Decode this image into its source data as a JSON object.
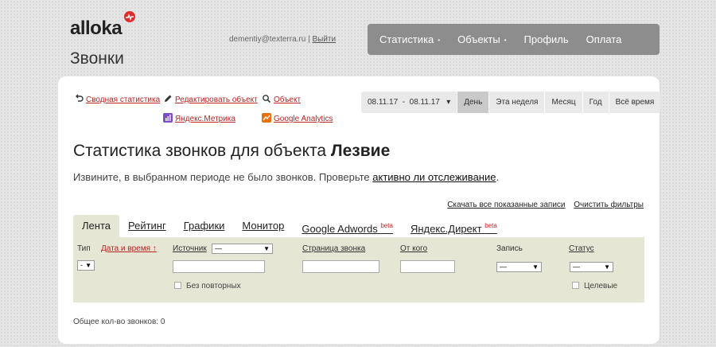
{
  "header": {
    "logo_text": "alloka",
    "page_title": "Звонки",
    "user_email": "dementiy@texterra.ru",
    "separator": "|",
    "logout_label": "Выйти"
  },
  "topnav": {
    "items": [
      {
        "label": "Статистика",
        "has_caret": true
      },
      {
        "label": "Объекты",
        "has_caret": true
      },
      {
        "label": "Профиль",
        "has_caret": false
      },
      {
        "label": "Оплата",
        "has_caret": false
      }
    ],
    "caret": "•",
    "bg_color": "#8d8d8d"
  },
  "actions": {
    "summary_stats": "Сводная статистика",
    "edit_object": "Редактировать объект",
    "object": "Объект",
    "yandex_metrika": "Яндекс.Метрика",
    "google_analytics": "Google Analytics"
  },
  "period": {
    "date_from": "08.11.17",
    "dash": "-",
    "date_to": "08.11.17",
    "dropdown_caret": "▾",
    "options": [
      "День",
      "Эта неделя",
      "Месяц",
      "Год",
      "Всё время"
    ],
    "active": "День"
  },
  "main": {
    "heading_prefix": "Статистика звонков для объекта ",
    "object_name": "Лезвие",
    "notice_text": "Извините, в выбранном периоде не было звонков. Проверьте ",
    "notice_link": "активно ли отслеживание",
    "notice_end": "."
  },
  "table_links": {
    "download_all": "Скачать все показанные записи",
    "clear_filters": "Очистить фильтры"
  },
  "tabs": [
    {
      "label": "Лента",
      "active": true,
      "beta": ""
    },
    {
      "label": "Рейтинг",
      "active": false,
      "beta": ""
    },
    {
      "label": "Графики",
      "active": false,
      "beta": ""
    },
    {
      "label": "Монитор",
      "active": false,
      "beta": ""
    },
    {
      "label": "Google Adwords",
      "active": false,
      "beta": "beta"
    },
    {
      "label": "Яндекс.Директ",
      "active": false,
      "beta": "beta"
    }
  ],
  "filters": {
    "type_label": "Тип",
    "type_value": "-",
    "datetime_label": "Дата и время",
    "sort_arrow": "↑",
    "source_label": "Источник",
    "source_value": "—",
    "no_repeat_label": "Без повторных",
    "page_label": "Страница звонка",
    "from_label": "От кого",
    "record_label": "Запись",
    "record_value": "—",
    "status_label": "Статус",
    "status_value": "—",
    "targeted_label": "Целевые",
    "select_arrow": "▼"
  },
  "summary": {
    "total_calls": "Общее кол-во звонков: 0"
  },
  "colors": {
    "accent_red": "#c22222",
    "filter_bg": "#e6e6d5",
    "logo_badge": "#e02b2b"
  }
}
